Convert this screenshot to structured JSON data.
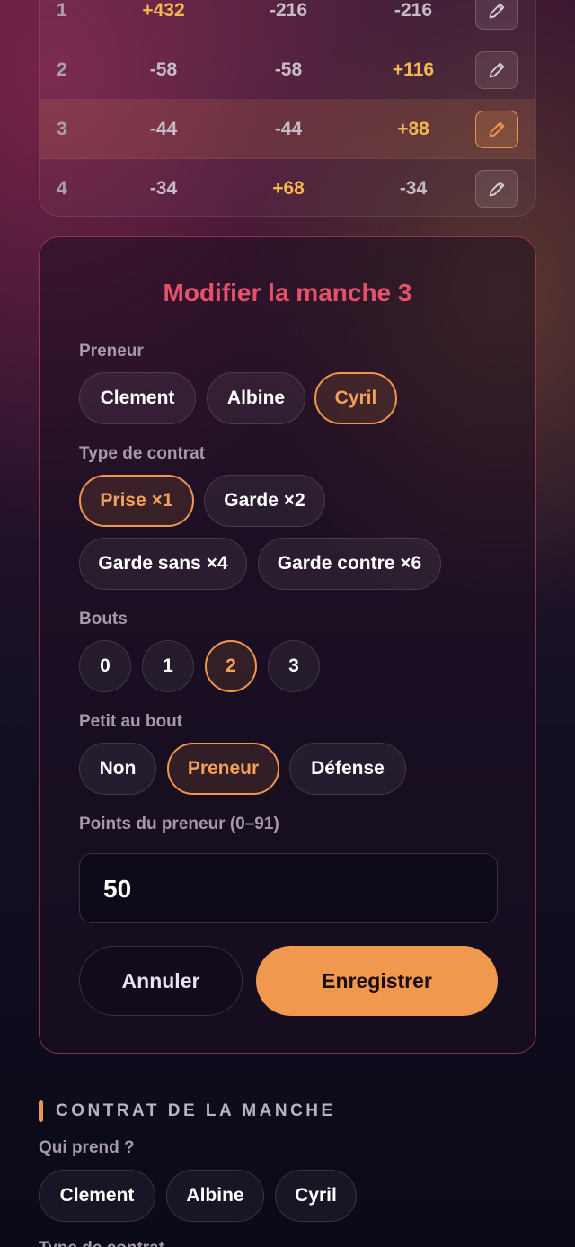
{
  "score_table": {
    "rows": [
      {
        "num": "1",
        "c1": "+432",
        "c2": "-216",
        "c3": "-216",
        "pos": [
          true,
          false,
          false
        ],
        "active": false
      },
      {
        "num": "2",
        "c1": "-58",
        "c2": "-58",
        "c3": "+116",
        "pos": [
          false,
          false,
          true
        ],
        "active": false
      },
      {
        "num": "3",
        "c1": "-44",
        "c2": "-44",
        "c3": "+88",
        "pos": [
          false,
          false,
          true
        ],
        "active": true
      },
      {
        "num": "4",
        "c1": "-34",
        "c2": "+68",
        "c3": "-34",
        "pos": [
          false,
          true,
          false
        ],
        "active": false
      }
    ],
    "edit_icon": "pencil-icon"
  },
  "edit_card": {
    "title": "Modifier la manche 3",
    "preneur": {
      "label": "Preneur",
      "options": [
        "Clement",
        "Albine",
        "Cyril"
      ],
      "selected": "Cyril"
    },
    "contrat": {
      "label": "Type de contrat",
      "options": [
        "Prise ×1",
        "Garde ×2",
        "Garde sans ×4",
        "Garde contre ×6"
      ],
      "selected": "Prise ×1"
    },
    "bouts": {
      "label": "Bouts",
      "options": [
        "0",
        "1",
        "2",
        "3"
      ],
      "selected": "2"
    },
    "petit": {
      "label": "Petit au bout",
      "options": [
        "Non",
        "Preneur",
        "Défense"
      ],
      "selected": "Preneur"
    },
    "points": {
      "label": "Points du preneur (0–91)",
      "value": "50"
    },
    "cancel_label": "Annuler",
    "save_label": "Enregistrer"
  },
  "contrat_section": {
    "header": "CONTRAT DE LA MANCHE",
    "who_label": "Qui prend ?",
    "players": [
      "Clement",
      "Albine",
      "Cyril"
    ],
    "next_label": "Type de contrat"
  },
  "colors": {
    "accent": "#f0964c",
    "title": "#e5506a",
    "positive": "#f4b850"
  }
}
